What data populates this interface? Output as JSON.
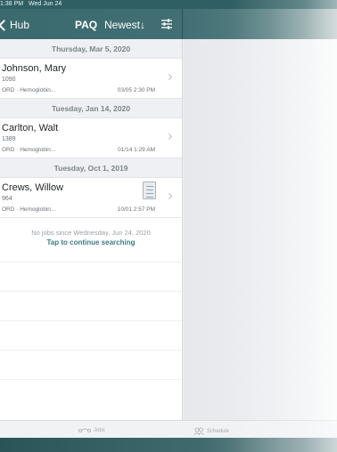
{
  "status_bar": {
    "time": "1:38 PM",
    "date": "Wed Jun 24"
  },
  "nav": {
    "back_label": "Hub",
    "paq_label": "PAQ",
    "sort_label": "Newest↓",
    "filter_icon": "sliders-icon"
  },
  "sections": [
    {
      "header": "Thursday, Mar 5, 2020",
      "rows": [
        {
          "name": "Johnson, Mary",
          "mrn": "1090",
          "order": "ORD · Hemoglobin...",
          "when": "03/05 2:30 PM"
        }
      ]
    },
    {
      "header": "Tuesday, Jan 14, 2020",
      "rows": [
        {
          "name": "Carlton, Walt",
          "mrn": "1389",
          "order": "ORD · Hemoglobin...",
          "when": "01/14 1:29 AM"
        }
      ]
    },
    {
      "header": "Tuesday, Oct 1, 2019",
      "rows": [
        {
          "name": "Crews, Willow",
          "mrn": "964",
          "order": "ORD · Hemoglobin...",
          "when": "10/01 2:57 PM"
        }
      ]
    }
  ],
  "end_message": {
    "line1": "No jobs since Wednesday, Jun 24, 2020",
    "line2": "Tap to continue searching"
  },
  "tabs": {
    "jobs": "Jobs",
    "schedule": "Schedule"
  },
  "colors": {
    "nav_teal": "#416f73",
    "link_teal": "#3e7c80"
  }
}
